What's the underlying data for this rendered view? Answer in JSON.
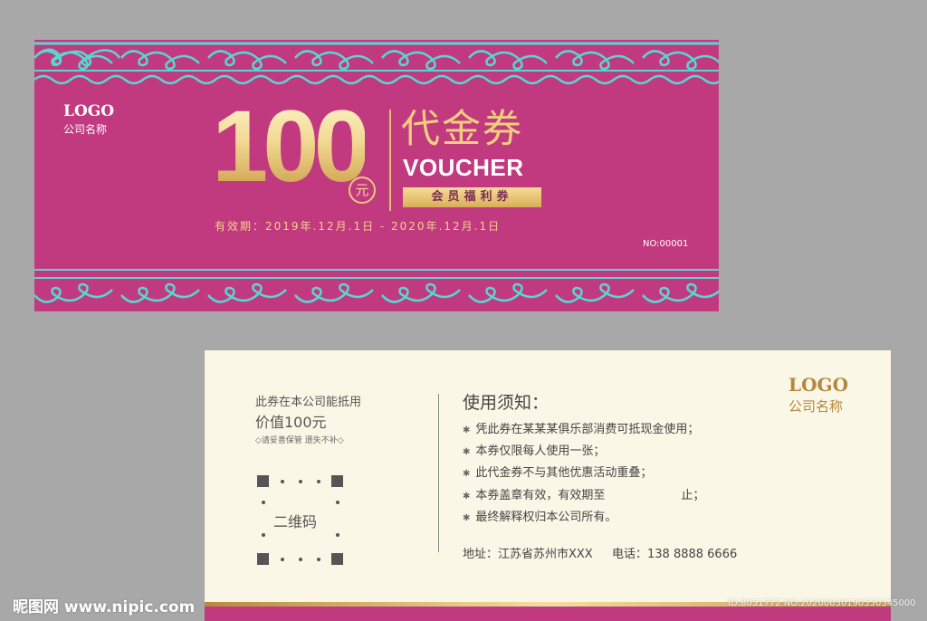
{
  "front": {
    "logo": "LOGO",
    "company": "公司名称",
    "amount": "100",
    "currency": "元",
    "title_cn": "代金券",
    "title_en": "VOUCHER",
    "member_tag": "会员福利券",
    "validity": "有效期：2019年.12月.1日 - 2020年.12月.1日",
    "serial": "NO:00001"
  },
  "back": {
    "redeem_line1": "此券在本公司能抵用",
    "redeem_line2": "价值100元",
    "keep_note": "◇请妥善保管 遗失不补◇",
    "qr_label": "二维码",
    "notice_title": "使用须知：",
    "rules": [
      "凭此券在某某某俱乐部消费可抵现金使用；",
      "本券仅限每人使用一张；",
      "此代金券不与其他优惠活动重叠；",
      "本券盖章有效，有效期至",
      "最终解释权归本公司所有。"
    ],
    "rule4_suffix": "止；",
    "address": "地址：江苏省苏州市XXX",
    "phone": "电话：138 8888 6666",
    "logo": "LOGO",
    "company": "公司名称"
  },
  "watermark": {
    "site": "昵图网 www.nipic.com",
    "id": "ID:8051772 NO:20200630190550345000"
  },
  "colors": {
    "magenta": "#c13a80",
    "gold": "#f0cf7d",
    "cyan_pattern": "#56d8d2",
    "cream": "#fbf7e6"
  }
}
